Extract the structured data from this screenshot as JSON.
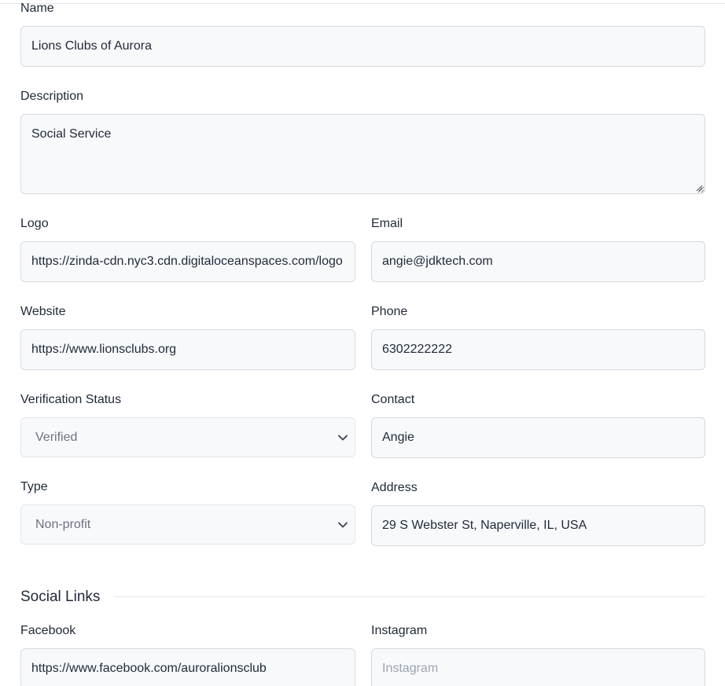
{
  "form": {
    "name": {
      "label": "Name",
      "value": "Lions Clubs of Aurora"
    },
    "description": {
      "label": "Description",
      "value": "Social Service"
    },
    "logo": {
      "label": "Logo",
      "value": "https://zinda-cdn.nyc3.cdn.digitaloceanspaces.com/logo"
    },
    "email": {
      "label": "Email",
      "value": "angie@jdktech.com"
    },
    "website": {
      "label": "Website",
      "value": "https://www.lionsclubs.org"
    },
    "phone": {
      "label": "Phone",
      "value": "6302222222"
    },
    "verification_status": {
      "label": "Verification Status",
      "selected": "Verified"
    },
    "contact": {
      "label": "Contact",
      "value": "Angie"
    },
    "type": {
      "label": "Type",
      "selected": "Non-profit"
    },
    "address": {
      "label": "Address",
      "value": "29 S Webster St, Naperville, IL, USA"
    }
  },
  "social_links": {
    "title": "Social Links",
    "facebook": {
      "label": "Facebook",
      "value": "https://www.facebook.com/auroralionsclub"
    },
    "instagram": {
      "label": "Instagram",
      "value": "",
      "placeholder": "Instagram"
    }
  },
  "icons": {
    "select_arrow": "chevron-down-icon",
    "textarea_grip": "resize-grip-icon"
  }
}
